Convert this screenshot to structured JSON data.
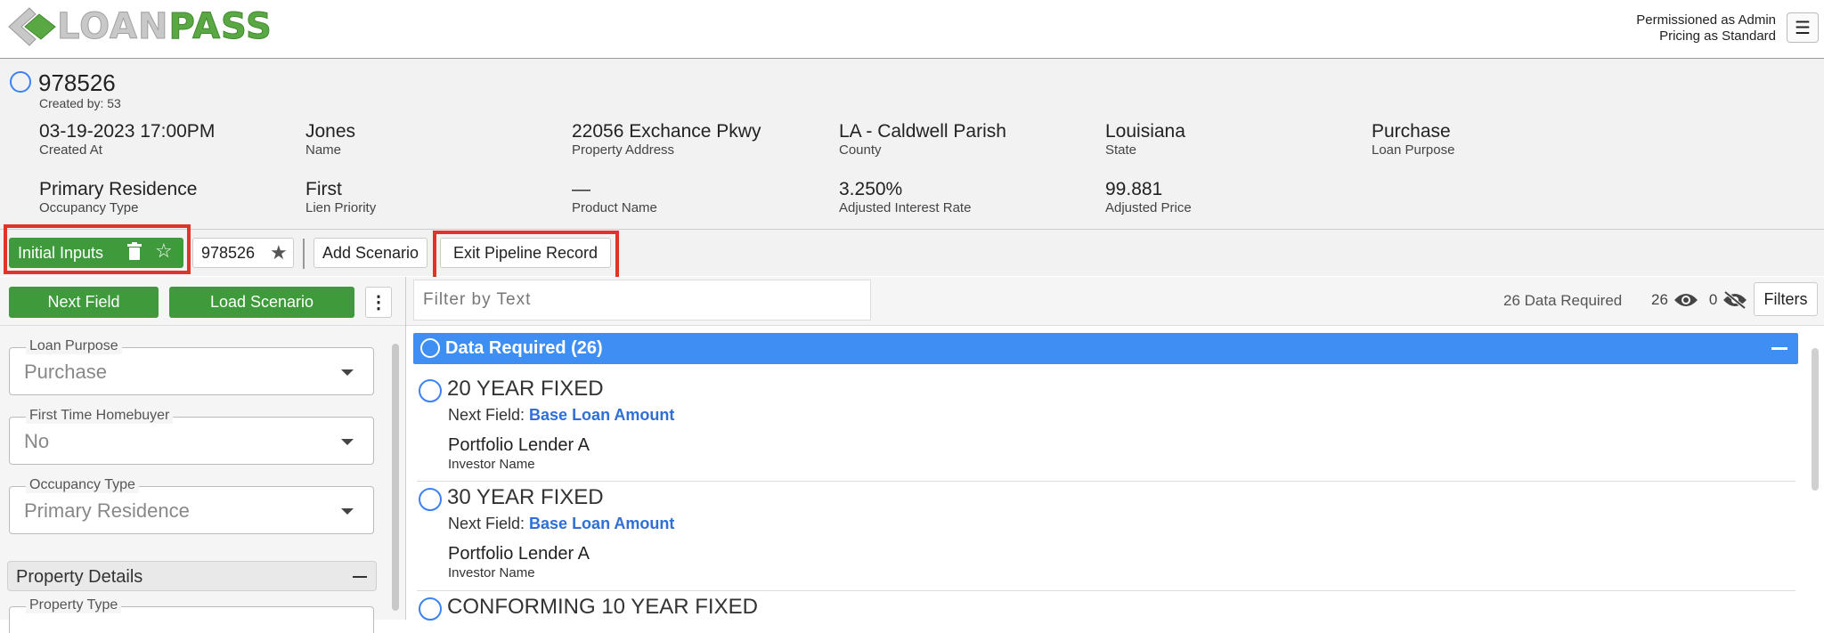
{
  "header": {
    "logo_loan": "LOAN",
    "logo_pass": "PASS",
    "permission_line1": "Permissioned as Admin",
    "permission_line2": "Pricing as Standard",
    "menu_icon": "hamburger-icon"
  },
  "record": {
    "id": "978526",
    "created_by": "Created by: 53",
    "fields": [
      {
        "value": "03-19-2023 17:00PM",
        "label": "Created At"
      },
      {
        "value": "Jones",
        "label": "Name"
      },
      {
        "value": "22056 Exchance Pkwy",
        "label": "Property Address"
      },
      {
        "value": "LA - Caldwell Parish",
        "label": "County"
      },
      {
        "value": "Louisiana",
        "label": "State"
      },
      {
        "value": "Purchase",
        "label": "Loan Purpose"
      },
      {
        "value": "Primary Residence",
        "label": "Occupancy Type"
      },
      {
        "value": "First",
        "label": "Lien Priority"
      },
      {
        "value": "—",
        "label": "Product Name"
      },
      {
        "value": "3.250%",
        "label": "Adjusted Interest Rate"
      },
      {
        "value": "99.881",
        "label": "Adjusted Price"
      }
    ]
  },
  "scenarios": {
    "initial_inputs": "Initial Inputs",
    "scenario_id": "978526",
    "add_scenario": "Add Scenario",
    "exit_pipeline": "Exit Pipeline Record"
  },
  "left": {
    "next_field": "Next Field",
    "load_scenario": "Load Scenario",
    "selects": [
      {
        "legend": "Loan Purpose",
        "value": "Purchase"
      },
      {
        "legend": "First Time Homebuyer",
        "value": "No"
      },
      {
        "legend": "Occupancy Type",
        "value": "Primary Residence"
      }
    ],
    "property_details": "Property Details",
    "property_type_legend": "Property Type"
  },
  "right": {
    "filter_placeholder": "Filter by Text",
    "data_required_count": "26 Data Required",
    "visible_count": "26",
    "hidden_count": "0",
    "filters_label": "Filters",
    "group_title": "Data Required (26)",
    "next_field_prefix": "Next Field: ",
    "products": [
      {
        "name": "20 YEAR FIXED",
        "next_field": "Base Loan Amount",
        "lender": "Portfolio Lender A",
        "lender_label": "Investor Name"
      },
      {
        "name": "30 YEAR FIXED",
        "next_field": "Base Loan Amount",
        "lender": "Portfolio Lender A",
        "lender_label": "Investor Name"
      },
      {
        "name": "CONFORMING 10 YEAR FIXED"
      }
    ]
  },
  "colors": {
    "brand_green": "#3f9a3c",
    "accent_blue": "#3f8ef3",
    "highlight_red": "#e0332a"
  }
}
